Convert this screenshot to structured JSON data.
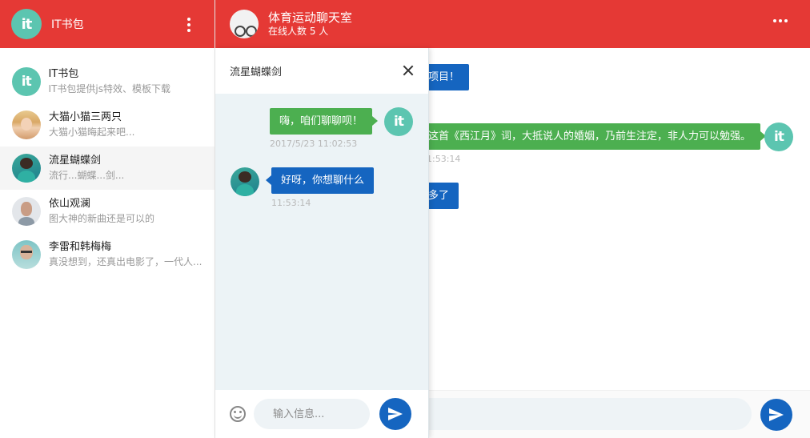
{
  "app": {
    "name": "IT书包",
    "logo_text": "it"
  },
  "colors": {
    "header_red": "#e53935",
    "bubble_blue": "#1565c0",
    "bubble_green": "#4caf50",
    "logo_teal": "#5cc5b0"
  },
  "contacts": [
    {
      "name": "IT书包",
      "last_message": "IT书包提供js特效、模板下载",
      "avatar": "it-logo"
    },
    {
      "name": "大猫小猫三两只",
      "last_message": "大猫小猫晦起来吧...",
      "avatar": "blonde-woman-avatar"
    },
    {
      "name": "流星蝴蝶剑",
      "last_message": "流行...蝴蝶...剑...",
      "avatar": "teal-shirt-man-avatar"
    },
    {
      "name": "依山观澜",
      "last_message": "图大神的新曲还是可以的",
      "avatar": "bearded-man-avatar"
    },
    {
      "name": "李雷和韩梅梅",
      "last_message": "真没想到，还真出电影了，一代人...",
      "avatar": "glasses-man-avatar"
    }
  ],
  "room": {
    "title": "体育运动聊天室",
    "online": "在线人数 5 人",
    "avatar": "cyclist-avatar",
    "messages": [
      {
        "text": "项目！",
        "side": "left"
      },
      {
        "text": "这首《西江月》词，大抵说人的婚姻，乃前生注定，非人力可以勉强。",
        "side": "right",
        "time": "1:53:14"
      },
      {
        "text": "多了",
        "side": "left"
      }
    ]
  },
  "private_chat": {
    "title": "流星蝴蝶剑",
    "input_placeholder": "输入信息...",
    "messages": [
      {
        "text": "嗨，咱们聊聊呗！",
        "side": "right",
        "time": "2017/5/23 11:02:53"
      },
      {
        "text": "好呀，你想聊什么",
        "side": "left",
        "time": "11:53:14"
      }
    ]
  }
}
